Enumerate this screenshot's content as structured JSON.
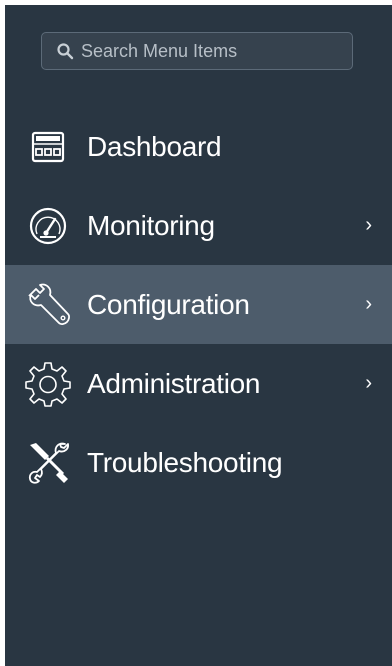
{
  "search": {
    "placeholder": "Search Menu Items"
  },
  "menu": {
    "items": [
      {
        "label": "Dashboard",
        "icon": "dashboard-icon",
        "has_submenu": false,
        "active": false
      },
      {
        "label": "Monitoring",
        "icon": "gauge-icon",
        "has_submenu": true,
        "active": false
      },
      {
        "label": "Configuration",
        "icon": "wrench-icon",
        "has_submenu": true,
        "active": true
      },
      {
        "label": "Administration",
        "icon": "gear-icon",
        "has_submenu": true,
        "active": false
      },
      {
        "label": "Troubleshooting",
        "icon": "tools-icon",
        "has_submenu": false,
        "active": false
      }
    ],
    "chevron": "›"
  },
  "colors": {
    "sidebar_bg": "#293642",
    "active_bg": "#4d5c6b",
    "text": "#ffffff"
  }
}
